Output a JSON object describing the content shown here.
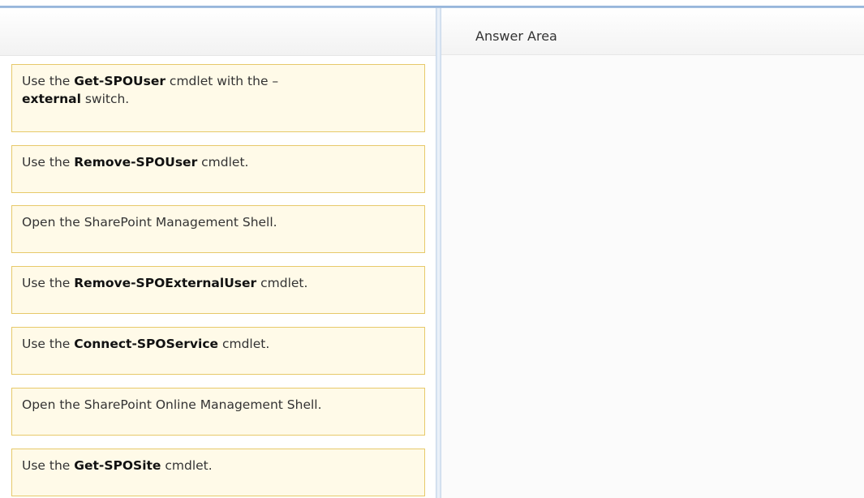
{
  "answer_area": {
    "title": "Answer Area"
  },
  "items": [
    {
      "pre": "Use the ",
      "bold": "Get-SPOUser",
      "mid": " cmdlet with the –",
      "bold2": "external",
      "post": " switch."
    },
    {
      "pre": "Use the ",
      "bold": "Remove-SPOUser",
      "post": " cmdlet."
    },
    {
      "text": "Open the SharePoint Management Shell."
    },
    {
      "pre": "Use the ",
      "bold": "Remove-SPOExternalUser",
      "post": " cmdlet."
    },
    {
      "pre": "Use the ",
      "bold": "Connect-SPOService",
      "post": " cmdlet."
    },
    {
      "text": "Open the SharePoint Online Management Shell."
    },
    {
      "pre": "Use the ",
      "bold": "Get-SPOSite",
      "post": " cmdlet."
    }
  ]
}
